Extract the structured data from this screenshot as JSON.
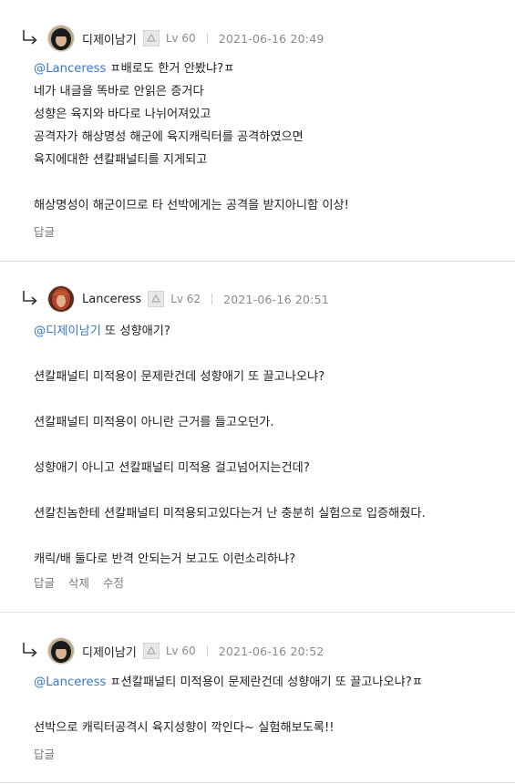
{
  "comments": [
    {
      "username": "디제이남기",
      "level": "Lv 60",
      "datetime": "2021-06-16 20:49",
      "lines": [
        {
          "mention": "@Lanceress",
          "text": " ㅍ배로도 한거 안봤냐?ㅍ"
        },
        {
          "mention": "",
          "text": "네가 내글을 똑바로 안읽은 증거다"
        },
        {
          "mention": "",
          "text": "성향은 육지와 바다로 나뉘어져있고"
        },
        {
          "mention": "",
          "text": "공격자가 해상명성 해군에 육지캐릭터를 공격하였으면"
        },
        {
          "mention": "",
          "text": "육지에대한 션칼패널티를 지게되고"
        },
        {
          "mention": "",
          "text": ""
        },
        {
          "mention": "",
          "text": "해상명성이 해군이므로 타 선박에게는 공격을 받지아니함 이상!"
        }
      ],
      "actions": [
        "답글"
      ]
    },
    {
      "username": "Lanceress",
      "level": "Lv 62",
      "datetime": "2021-06-16 20:51",
      "lines": [
        {
          "mention": "@디제이남기",
          "text": " 또 성향애기?"
        },
        {
          "mention": "",
          "text": ""
        },
        {
          "mention": "",
          "text": "션칼패널티 미적용이 문제란건데 성향애기 또 끌고나오냐?"
        },
        {
          "mention": "",
          "text": ""
        },
        {
          "mention": "",
          "text": "션칼패널티 미적용이 아니란 근거를 들고오던가."
        },
        {
          "mention": "",
          "text": ""
        },
        {
          "mention": "",
          "text": "성향애기 아니고 션칼패널티 미적용 걸고넘어지는건데?"
        },
        {
          "mention": "",
          "text": ""
        },
        {
          "mention": "",
          "text": "션칼친놈한테 션칼패널티 미적용되고있다는거 난 충분히 실험으로 입증해줬다."
        },
        {
          "mention": "",
          "text": ""
        },
        {
          "mention": "",
          "text": "캐릭/배 둘다로 반격 안되는거 보고도 이런소리하냐?"
        }
      ],
      "actions": [
        "답글",
        "삭제",
        "수정"
      ]
    },
    {
      "username": "디제이남기",
      "level": "Lv 60",
      "datetime": "2021-06-16 20:52",
      "lines": [
        {
          "mention": "@Lanceress",
          "text": " ㅍ션칼패널티 미적용이 문제란건데 성향애기 또 끌고나오냐?ㅍ"
        },
        {
          "mention": "",
          "text": ""
        },
        {
          "mention": "",
          "text": "선박으로 캐릭터공격시 육지성향이 깍인다~ 실험해보도록!!"
        }
      ],
      "actions": [
        "답글"
      ]
    }
  ]
}
